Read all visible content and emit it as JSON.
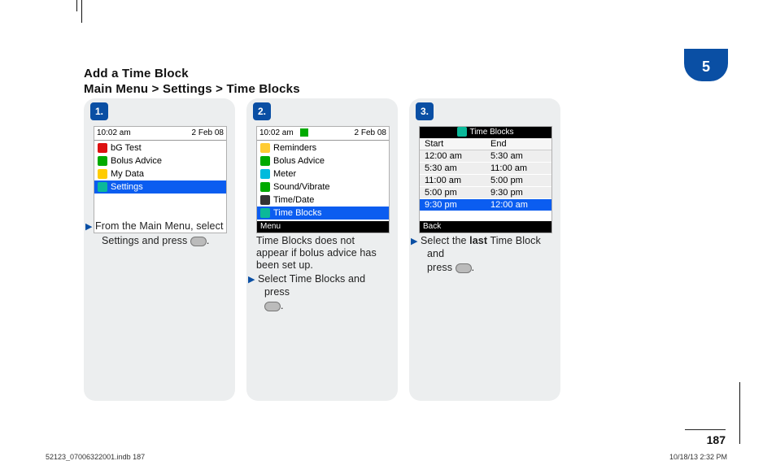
{
  "chapter": {
    "number": "5"
  },
  "heading": {
    "line1": "Add a Time Block",
    "line2": "Main Menu > Settings > Time Blocks"
  },
  "steps": [
    {
      "number": "1.",
      "screen": {
        "clock": "10:02 am",
        "date": "2 Feb 08",
        "items": [
          "bG Test",
          "Bolus Advice",
          "My Data",
          "Settings"
        ],
        "selected_index": 3
      },
      "caption_a": "From the Main Menu, select",
      "caption_b": "Settings and press"
    },
    {
      "number": "2.",
      "screen": {
        "clock": "10:02 am",
        "date": "2 Feb 08",
        "items": [
          "Reminders",
          "Bolus Advice",
          "Meter",
          "Sound/Vibrate",
          "Time/Date",
          "Time Blocks"
        ],
        "selected_index": 5,
        "softkey": "Menu"
      },
      "caption_a": "Time Blocks does not appear if bolus advice has been set up.",
      "caption_b": "Select Time Blocks and press"
    },
    {
      "number": "3.",
      "screen": {
        "title": "Time Blocks",
        "cols": [
          "Start",
          "End"
        ],
        "rows": [
          [
            "12:00 am",
            "5:30 am"
          ],
          [
            "5:30 am",
            "11:00 am"
          ],
          [
            "11:00 am",
            "5:00 pm"
          ],
          [
            "5:00 pm",
            "9:30 pm"
          ],
          [
            "9:30 pm",
            "12:00 am"
          ]
        ],
        "selected_index": 4,
        "softkey": "Back"
      },
      "caption_a": "Select the",
      "caption_bold": "last",
      "caption_b": "Time Block and",
      "caption_c": "press"
    }
  ],
  "footer": {
    "page": "187",
    "slug_left": "52123_07006322001.indb   187",
    "slug_right": "10/18/13   2:32 PM"
  }
}
